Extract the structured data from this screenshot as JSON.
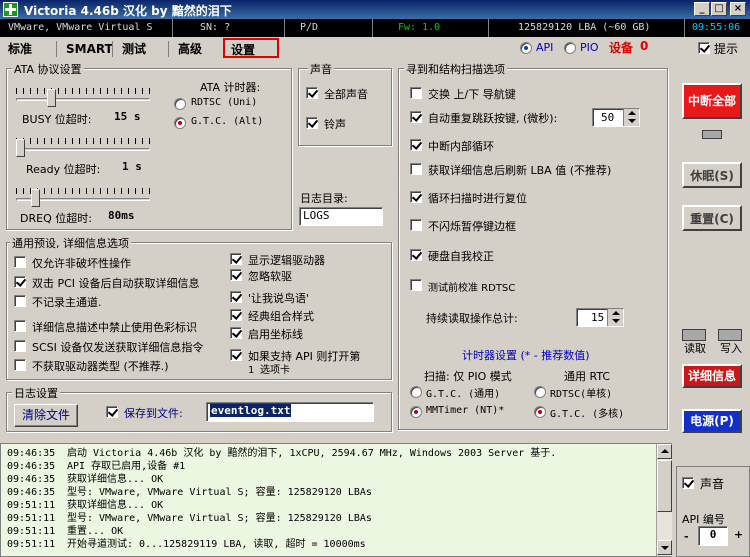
{
  "title": "Victoria 4.46b 汉化 by 黯然的泪下",
  "window_buttons": {
    "minimize": "_",
    "maximize": "□",
    "close": "×"
  },
  "status": {
    "drive": "VMware, VMware Virtual S",
    "sn": "SN: ?",
    "pd": "P/D",
    "fw": "Fw: 1.0",
    "lba": "125829120 LBA (~60 GB)",
    "time": "09:55:06"
  },
  "tabs": [
    "标准",
    "SMART",
    "测试",
    "高级",
    "设置"
  ],
  "active_tab": "设置",
  "mode": {
    "api": "API",
    "pio": "PIO",
    "device_label": "设备",
    "device_num": "0",
    "hint": "提示"
  },
  "ata": {
    "title": "ATA 协议设置",
    "busy_label": "BUSY 位超时:",
    "busy_value": "15 s",
    "busy_level": 0.25,
    "ready_label": "Ready 位超时:",
    "ready_value": "1 s",
    "ready_level": 0.0,
    "dreq_label": "DREQ 位超时:",
    "dreq_value": "80ms",
    "dreq_level": 0.12,
    "timer_title": "ATA 计时器:",
    "rdtsc": "RDTSC (Uni)",
    "gtc": "G.T.C. (Alt)"
  },
  "sound": {
    "title": "声音",
    "all_sound": "全部声音",
    "bell": "铃声"
  },
  "log_dir": {
    "label": "日志目录:",
    "value": "LOGS"
  },
  "seek": {
    "title": "寻到和结构扫描选项",
    "swap": "交换 上/下 导航键",
    "auto_repeat": "自动重复跳跃按键, (微秒):",
    "auto_repeat_value": "50",
    "internal_loop": "中断内部循环",
    "refresh_lba": "获取详细信息后刷新 LBA 值 (不推荐)",
    "loop_reset": "循环扫描时进行复位",
    "no_blink": "不闪烁暂停键边框",
    "selftest": "硬盘自我校正",
    "rdtsc_test": "测试前校准 RDTSC",
    "total_label": "持续读取操作总计:",
    "total_value": "15"
  },
  "timer_settings": {
    "title": "计时器设置 (* - 推荐数值)",
    "scan_mode": "扫描: 仅 PIO 模式",
    "gtc_general": "G.T.C. (通用)",
    "mmtimer": "MMTimer (NT)*",
    "general_rtc": "通用 RTC",
    "rdtsc_single": "RDTSC(单核)",
    "gtc_multi": "G.T.C. (多核)"
  },
  "general": {
    "title": "通用预设, 详细信息选项",
    "opt1": "仅允许非破坏性操作",
    "opt2": "双击 PCI 设备后自动获取详细信息",
    "opt3": "不记录主通道.",
    "opt4": "详细信息描述中禁止使用色彩标识",
    "opt5": "SCSI 设备仅发送获取详细信息指令",
    "opt6": "不获取驱动器类型 (不推荐.)",
    "opt7": "显示逻辑驱动器",
    "opt8": "忽略软驱",
    "opt9": "'让我说鸟语'",
    "opt10": "经典组合样式",
    "opt11": "启用坐标线",
    "opt12a": "如果支持 API 则打开第",
    "opt12b": "1 选项卡"
  },
  "logset": {
    "title": "日志设置",
    "clear": "清除文件",
    "save_to": "保存到文件:",
    "file": "eventlog.txt"
  },
  "right": {
    "stop": "中断全部",
    "sleep": "休眠(S)",
    "reset": "重置(C)",
    "read": "读取",
    "write": "写入",
    "details": "详细信息",
    "power": "电源(P)",
    "sound": "声音",
    "api_num_label": "API 编号",
    "api_num": "0",
    "minus": "-",
    "plus": "+"
  },
  "log": [
    {
      "t": "09:46:35",
      "m": "启动 Victoria 4.46b 汉化 by 黯然的泪下, 1xCPU, 2594.67 MHz, Windows 2003 Server 基于."
    },
    {
      "t": "09:46:35",
      "m": "API 存取已启用,设备 #1"
    },
    {
      "t": "09:46:35",
      "m": "获取详细信息... OK"
    },
    {
      "t": "09:46:35",
      "m": "型号:  VMware, VMware Virtual S;      容量: 125829120 LBAs"
    },
    {
      "t": "09:51:11",
      "m": "获取详细信息... OK"
    },
    {
      "t": "09:51:11",
      "m": "型号:  VMware, VMware Virtual S;      容量: 125829120 LBAs"
    },
    {
      "t": "09:51:11",
      "m": "重置... OK"
    },
    {
      "t": "09:51:11",
      "m": "开始寻道测试: 0...125829119 LBA, 读取, 超时 = 10000ms"
    }
  ],
  "colors": {
    "stop_btn": "#e81818",
    "details_btn": "#c81818",
    "power_btn": "#1030c8",
    "log_bg": "#ebf7e0"
  }
}
